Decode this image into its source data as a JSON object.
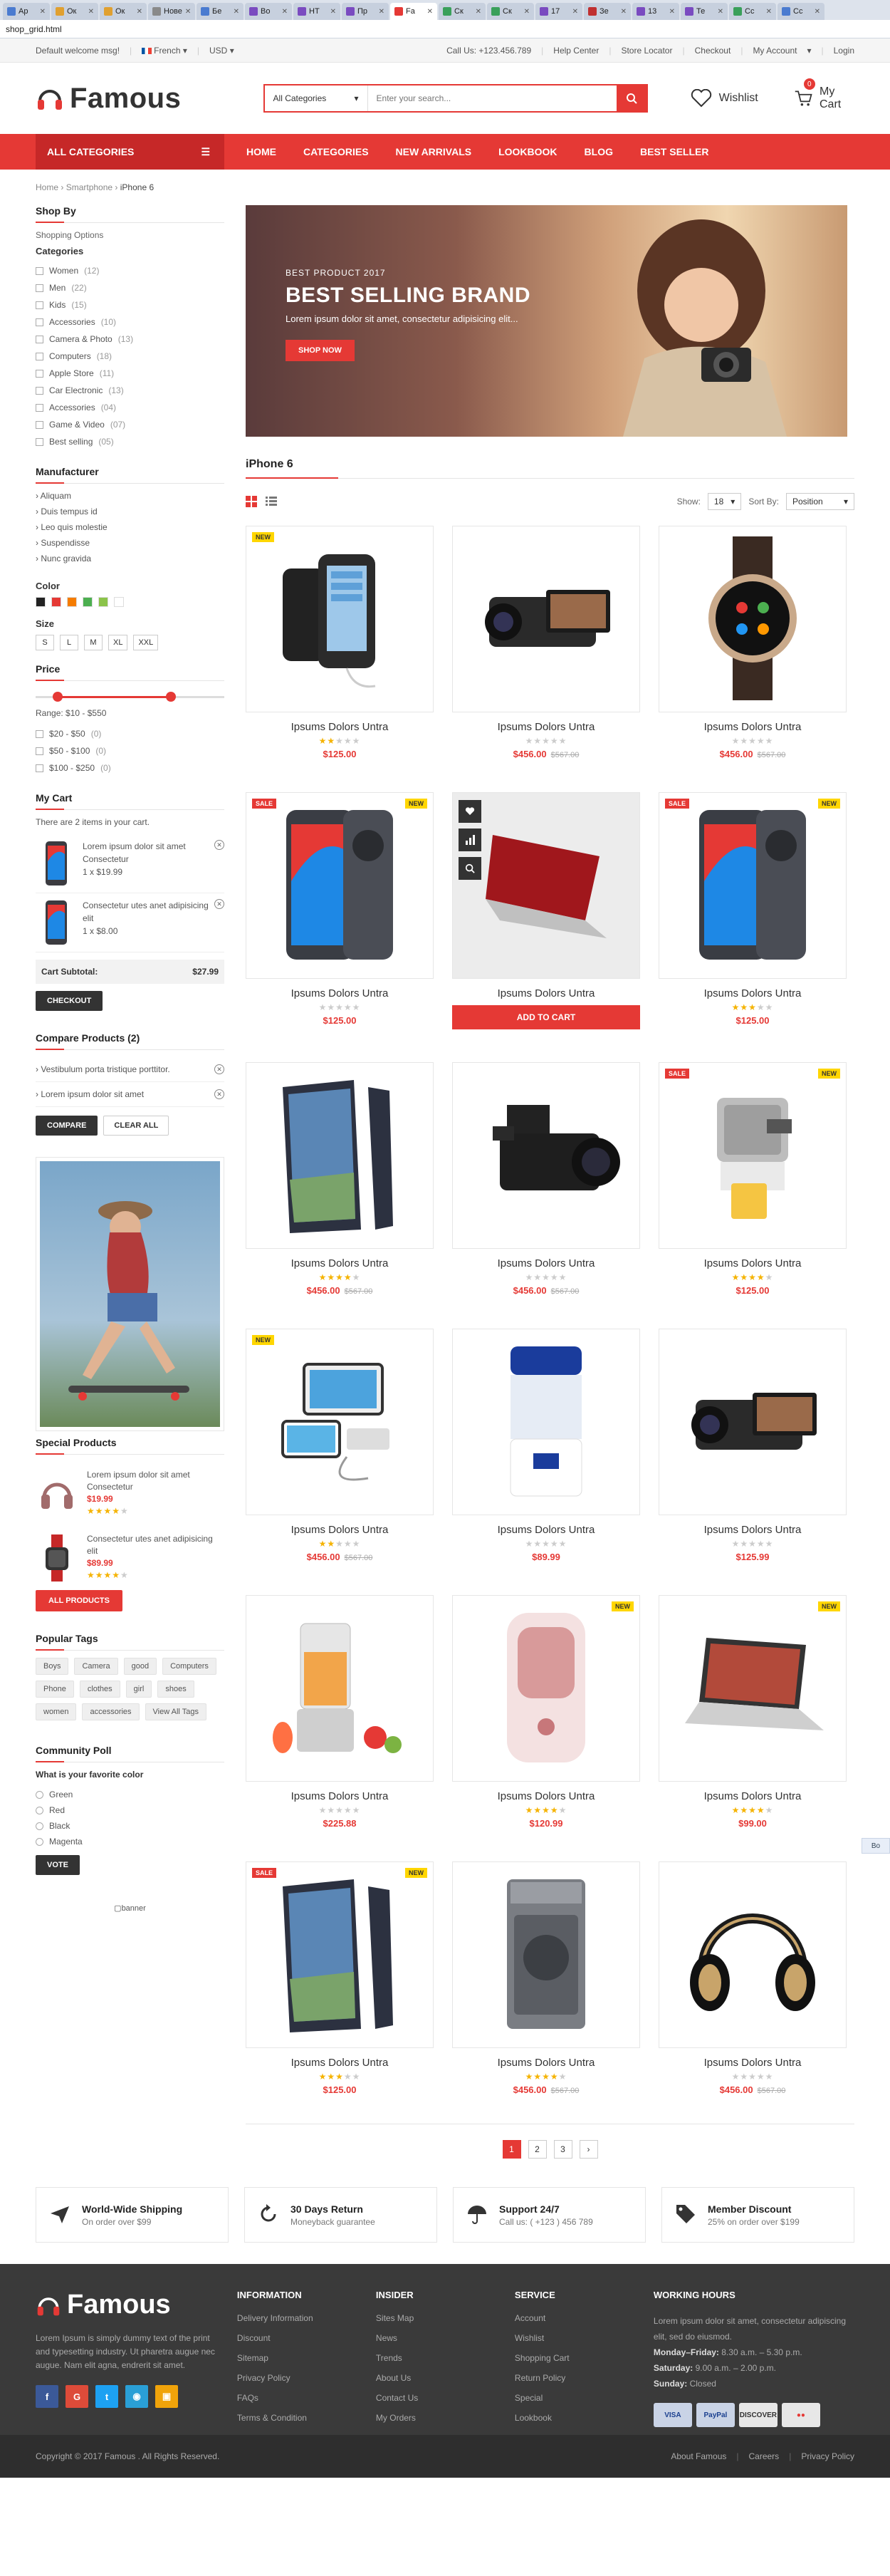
{
  "browser": {
    "tabs": [
      {
        "label": "Ap",
        "color": "#4a7bd0"
      },
      {
        "label": "Ок",
        "color": "#e0a030"
      },
      {
        "label": "Ок",
        "color": "#e0a030"
      },
      {
        "label": "Нове",
        "color": "#8a8a8a"
      },
      {
        "label": "Бе",
        "color": "#4a7bd0"
      },
      {
        "label": "Во",
        "color": "#7a4bc0"
      },
      {
        "label": "НТ",
        "color": "#7a4bc0"
      },
      {
        "label": "Пр",
        "color": "#7a4bc0"
      },
      {
        "label": "Fa",
        "color": "#e53935",
        "active": true
      },
      {
        "label": "Ск",
        "color": "#3aa05a"
      },
      {
        "label": "Ск",
        "color": "#3aa05a"
      },
      {
        "label": "17",
        "color": "#7a4bc0"
      },
      {
        "label": "Зе",
        "color": "#c03030"
      },
      {
        "label": "13",
        "color": "#7a4bc0"
      },
      {
        "label": "Те",
        "color": "#7a4bc0"
      },
      {
        "label": "Сс",
        "color": "#3aa05a"
      },
      {
        "label": "Сс",
        "color": "#4a7bd0"
      }
    ],
    "url": "shop_grid.html"
  },
  "topbar": {
    "welcome": "Default welcome msg!",
    "language": "French",
    "currency": "USD",
    "phone": "Call Us: +123.456.789",
    "links": [
      "Help Center",
      "Store Locator",
      "Checkout",
      "My Account",
      "Login"
    ]
  },
  "header": {
    "logo": "Famous",
    "search": {
      "category": "All Categories",
      "placeholder": "Enter your search..."
    },
    "wishlist": "Wishlist",
    "cart": "My Cart",
    "cart_count": "0"
  },
  "nav": {
    "all_categories": "ALL CATEGORIES",
    "links": [
      "HOME",
      "CATEGORIES",
      "NEW ARRIVALS",
      "LOOKBOOK",
      "BLOG",
      "BEST SELLER"
    ]
  },
  "breadcrumb": {
    "items": [
      "Home",
      "Smartphone",
      "iPhone 6"
    ],
    "sep": "›"
  },
  "sidebar": {
    "shop_by": "Shop By",
    "shopping_options": "Shopping Options",
    "categories_title": "Categories",
    "categories": [
      {
        "label": "Women",
        "count": "(12)"
      },
      {
        "label": "Men",
        "count": "(22)"
      },
      {
        "label": "Kids",
        "count": "(15)"
      },
      {
        "label": "Accessories",
        "count": "(10)"
      },
      {
        "label": "Camera & Photo",
        "count": "(13)"
      },
      {
        "label": "Computers",
        "count": "(18)"
      },
      {
        "label": "Apple Store",
        "count": "(11)"
      },
      {
        "label": "Car Electronic",
        "count": "(13)"
      },
      {
        "label": "Accessories",
        "count": "(04)"
      },
      {
        "label": "Game & Video",
        "count": "(07)"
      },
      {
        "label": "Best selling",
        "count": "(05)"
      }
    ],
    "manufacturer_title": "Manufacturer",
    "manufacturers": [
      "› Aliquam",
      "› Duis tempus id",
      "› Leo quis molestie",
      "› Suspendisse",
      "› Nunc gravida"
    ],
    "color_title": "Color",
    "colors": [
      "#222222",
      "#e53935",
      "#f57c00",
      "#4caf50",
      "#8bc34a",
      "#ffffff"
    ],
    "size_title": "Size",
    "sizes": [
      "S",
      "L",
      "M",
      "XL",
      "XXL"
    ],
    "price_title": "Price",
    "price_range": {
      "min": 10,
      "max": 550,
      "label": "Range: $10 - $550"
    },
    "price_options": [
      {
        "label": "$20 - $50",
        "count": "(0)"
      },
      {
        "label": "$50 - $100",
        "count": "(0)"
      },
      {
        "label": "$100 - $250",
        "count": "(0)"
      }
    ],
    "mycart_title": "My Cart",
    "mycart_text": "There are 2 items in your cart.",
    "cart_items": [
      {
        "name": "Lorem ipsum dolor sit amet Consectetur",
        "qty_price": "1 x $19.99"
      },
      {
        "name": "Consectetur utes anet adipisicing elit",
        "qty_price": "1 x $8.00"
      }
    ],
    "subtotal_label": "Cart Subtotal:",
    "subtotal_value": "$27.99",
    "checkout": "CHECKOUT",
    "compare_title": "Compare Products (2)",
    "compare_items": [
      "Vestibulum porta tristique porttitor.",
      "Lorem ipsum dolor sit amet"
    ],
    "compare_btn": "COMPARE",
    "clear_btn": "CLEAR ALL",
    "special_title": "Special Products",
    "special_items": [
      {
        "name": "Lorem ipsum dolor sit amet Consectetur",
        "price": "$19.99",
        "rating": 4
      },
      {
        "name": "Consectetur utes anet adipisicing elit",
        "price": "$89.99",
        "rating": 4
      }
    ],
    "all_products": "ALL PRODUCTS",
    "tags_title": "Popular Tags",
    "tags": [
      "Boys",
      "Camera",
      "good",
      "Computers",
      "Phone",
      "clothes",
      "girl",
      "shoes",
      "women",
      "accessories",
      "View All Tags"
    ],
    "poll_title": "Community Poll",
    "poll_question": "What is your favorite color",
    "poll_options": [
      "Green",
      "Red",
      "Black",
      "Magenta"
    ],
    "vote": "VOTE",
    "banner_alt": "banner"
  },
  "hero": {
    "eyebrow": "BEST PRODUCT 2017",
    "title": "BEST SELLING BRAND",
    "desc": "Lorem ipsum dolor sit amet, consectetur adipisicing elit...",
    "cta": "SHOP NOW"
  },
  "listing": {
    "title": "iPhone 6",
    "show_label": "Show:",
    "show_value": "18",
    "sort_label": "Sort By:",
    "sort_value": "Position",
    "add_to_cart": "ADD TO CART",
    "products": [
      {
        "name": "Ipsums Dolors Untra",
        "price": "$125.00",
        "old": "",
        "rating": 2,
        "badge_new": "NEW",
        "badge_new_left": true,
        "badge_sale": "",
        "img": "armband"
      },
      {
        "name": "Ipsums Dolors Untra",
        "price": "$456.00",
        "old": "$567.00",
        "rating": 0,
        "badge_new": "",
        "badge_sale": "",
        "img": "camcorder"
      },
      {
        "name": "Ipsums Dolors Untra",
        "price": "$456.00",
        "old": "$567.00",
        "rating": 0,
        "badge_new": "",
        "badge_sale": "",
        "img": "watch"
      },
      {
        "name": "Ipsums Dolors Untra",
        "price": "$125.00",
        "old": "",
        "rating": 0,
        "badge_new": "NEW",
        "badge_sale": "SALE",
        "img": "phone"
      },
      {
        "name": "Ipsums Dolors Untra",
        "price": "",
        "old": "",
        "rating": 0,
        "badge_new": "",
        "badge_sale": "",
        "img": "laptop-red",
        "hover": true
      },
      {
        "name": "Ipsums Dolors Untra",
        "price": "$125.00",
        "old": "",
        "rating": 3,
        "badge_new": "NEW",
        "badge_sale": "SALE",
        "img": "phone"
      },
      {
        "name": "Ipsums Dolors Untra",
        "price": "$456.00",
        "old": "$567.00",
        "rating": 4,
        "badge_new": "",
        "badge_sale": "",
        "img": "phone-side"
      },
      {
        "name": "Ipsums Dolors Untra",
        "price": "$456.00",
        "old": "$567.00",
        "rating": 0,
        "badge_new": "",
        "badge_sale": "",
        "img": "procam"
      },
      {
        "name": "Ipsums Dolors Untra",
        "price": "$125.00",
        "old": "",
        "rating": 4,
        "badge_new": "NEW",
        "badge_sale": "SALE",
        "img": "juicer"
      },
      {
        "name": "Ipsums Dolors Untra",
        "price": "$456.00",
        "old": "$567.00",
        "rating": 2,
        "badge_new": "NEW",
        "badge_new_left": true,
        "badge_sale": "",
        "img": "powerbank"
      },
      {
        "name": "Ipsums Dolors Untra",
        "price": "$89.99",
        "old": "",
        "rating": 0,
        "badge_new": "",
        "badge_sale": "",
        "img": "humidifier"
      },
      {
        "name": "Ipsums Dolors Untra",
        "price": "$125.99",
        "old": "",
        "rating": 0,
        "badge_new": "",
        "badge_sale": "",
        "img": "camcorder"
      },
      {
        "name": "Ipsums Dolors Untra",
        "price": "$225.88",
        "old": "",
        "rating": 0,
        "badge_new": "",
        "badge_sale": "",
        "img": "blender"
      },
      {
        "name": "Ipsums Dolors Untra",
        "price": "$120.99",
        "old": "",
        "rating": 4,
        "badge_new": "NEW",
        "badge_sale": "",
        "img": "purifier"
      },
      {
        "name": "Ipsums Dolors Untra",
        "price": "$99.00",
        "old": "",
        "rating": 4,
        "badge_new": "NEW",
        "badge_sale": "",
        "img": "laptop"
      },
      {
        "name": "Ipsums Dolors Untra",
        "price": "$125.00",
        "old": "",
        "rating": 3,
        "badge_new": "NEW",
        "badge_sale": "SALE",
        "img": "phone-side"
      },
      {
        "name": "Ipsums Dolors Untra",
        "price": "$456.00",
        "old": "$567.00",
        "rating": 4,
        "badge_new": "",
        "badge_sale": "",
        "img": "washer"
      },
      {
        "name": "Ipsums Dolors Untra",
        "price": "$456.00",
        "old": "$567.00",
        "rating": 0,
        "badge_new": "",
        "badge_sale": "",
        "img": "headphones"
      }
    ],
    "pages": [
      "1",
      "2",
      "3",
      "›"
    ]
  },
  "features": [
    {
      "title": "World-Wide Shipping",
      "sub": "On order over $99",
      "icon": "plane-icon"
    },
    {
      "title": "30 Days Return",
      "sub": "Moneyback guarantee",
      "icon": "return-icon"
    },
    {
      "title": "Support 24/7",
      "sub": "Call us: ( +123 ) 456 789",
      "icon": "umbrella-icon"
    },
    {
      "title": "Member Discount",
      "sub": "25% on order over $199",
      "icon": "tag-icon"
    }
  ],
  "footer": {
    "logo": "Famous",
    "about": "Lorem Ipsum is simply dummy text of the print and typesetting industry. Ut pharetra augue nec augue. Nam elit agna, endrerit sit amet.",
    "social": [
      {
        "label": "f",
        "color": "#3b5998"
      },
      {
        "label": "G",
        "color": "#dd4b39"
      },
      {
        "label": "t",
        "color": "#1da1f2"
      },
      {
        "label": "◉",
        "color": "#2a9fd6"
      },
      {
        "label": "▣",
        "color": "#f0a30a"
      }
    ],
    "cols": [
      {
        "title": "INFORMATION",
        "links": [
          "Delivery Information",
          "Discount",
          "Sitemap",
          "Privacy Policy",
          "FAQs",
          "Terms & Condition"
        ]
      },
      {
        "title": "INSIDER",
        "links": [
          "Sites Map",
          "News",
          "Trends",
          "About Us",
          "Contact Us",
          "My Orders"
        ]
      },
      {
        "title": "SERVICE",
        "links": [
          "Account",
          "Wishlist",
          "Shopping Cart",
          "Return Policy",
          "Special",
          "Lookbook"
        ]
      }
    ],
    "hours_title": "WORKING HOURS",
    "hours_intro": "Lorem ipsum dolor sit amet, consectetur adipiscing elit, sed do eiusmod.",
    "hours": [
      {
        "day": "Monday–Friday:",
        "time": " 8.30 a.m. – 5.30 p.m."
      },
      {
        "day": "Saturday:",
        "time": " 9.00 a.m. – 2.00 p.m."
      },
      {
        "day": "Sunday:",
        "time": " Closed"
      }
    ],
    "payments": [
      {
        "label": "VISA",
        "bg": "#c9d3e6",
        "fg": "#1a3f8f"
      },
      {
        "label": "PayPal",
        "bg": "#c9d3e6",
        "fg": "#1a3f8f"
      },
      {
        "label": "DISCOVER",
        "bg": "#e7e7e7",
        "fg": "#333"
      },
      {
        "label": "●●",
        "bg": "#e7e7e7",
        "fg": "#e53935"
      }
    ],
    "copyright": "Copyright © 2017 Famous . All Rights Reserved.",
    "bottom_links": [
      "About Famous",
      "Careers",
      "Privacy Policy"
    ]
  },
  "float_widget": "Bo"
}
